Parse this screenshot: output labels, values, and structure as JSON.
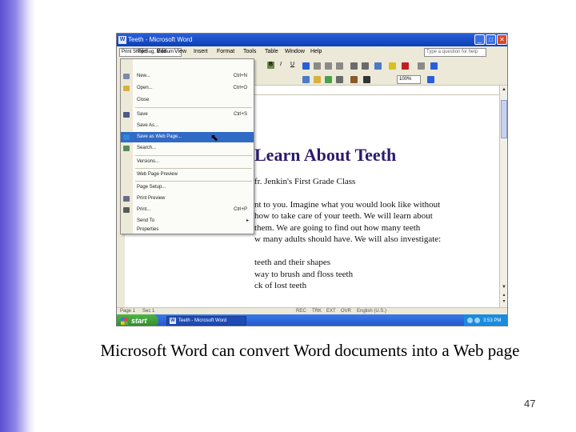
{
  "window": {
    "title": "Teeth - Microsoft Word",
    "app_icon_letter": "W",
    "minimize": "_",
    "maximize": "□",
    "close": "✕"
  },
  "menubar": {
    "font_name": "Print Shop Bug, Medium",
    "items": [
      "File",
      "Edit",
      "View",
      "Insert",
      "Format",
      "Tools",
      "Table",
      "Window",
      "Help"
    ],
    "help_placeholder": "Type a question for help"
  },
  "toolbar": {
    "bold": "B",
    "italic": "I",
    "underline": "U",
    "zoom": "100%"
  },
  "file_menu": {
    "items": [
      {
        "label": "New...",
        "shortcut": "Ctrl+N"
      },
      {
        "label": "Open...",
        "shortcut": "Ctrl+O"
      },
      {
        "label": "Close",
        "shortcut": ""
      },
      {
        "label": "Save",
        "shortcut": "Ctrl+S"
      },
      {
        "label": "Save As...",
        "shortcut": ""
      },
      {
        "label": "Save as Web Page...",
        "shortcut": ""
      },
      {
        "label": "Search...",
        "shortcut": ""
      },
      {
        "label": "Versions...",
        "shortcut": ""
      },
      {
        "label": "Web Page Preview",
        "shortcut": ""
      },
      {
        "label": "Page Setup...",
        "shortcut": ""
      },
      {
        "label": "Print Preview",
        "shortcut": ""
      },
      {
        "label": "Print...",
        "shortcut": "Ctrl+P"
      },
      {
        "label": "Send To",
        "shortcut": ""
      },
      {
        "label": "Properties",
        "shortcut": ""
      }
    ],
    "highlighted": "Save as Web Page..."
  },
  "document": {
    "title": "Learn About Teeth",
    "subtitle": "fr. Jenkin's First Grade Class",
    "lines": [
      "nt to you. Imagine what you would look like without",
      "how to take care of your teeth. We will learn about",
      "them. We are going to find out how many teeth",
      "w many adults should have. We will also investigate:",
      "",
      "teeth and their shapes",
      "way to brush and floss teeth",
      "ck of lost teeth"
    ]
  },
  "statusbar": {
    "page": "Page 1",
    "sec": "Sec 1",
    "fields": [
      "REC",
      "TRK",
      "EXT",
      "OVR",
      "English (U.S.)"
    ]
  },
  "taskbar": {
    "start": "start",
    "task": "Teeth - Microsoft Word",
    "clock": "3:53 PM"
  },
  "slide": {
    "caption": "Microsoft Word can convert Word documents into a Web page",
    "page_number": "47"
  },
  "colors": {
    "title_blue": "#2a5fd8",
    "doc_title": "#2b1a6e",
    "menu_highlight": "#316ac5",
    "start_green": "#4fb24a",
    "slide_bar": "#5a4fcf"
  }
}
